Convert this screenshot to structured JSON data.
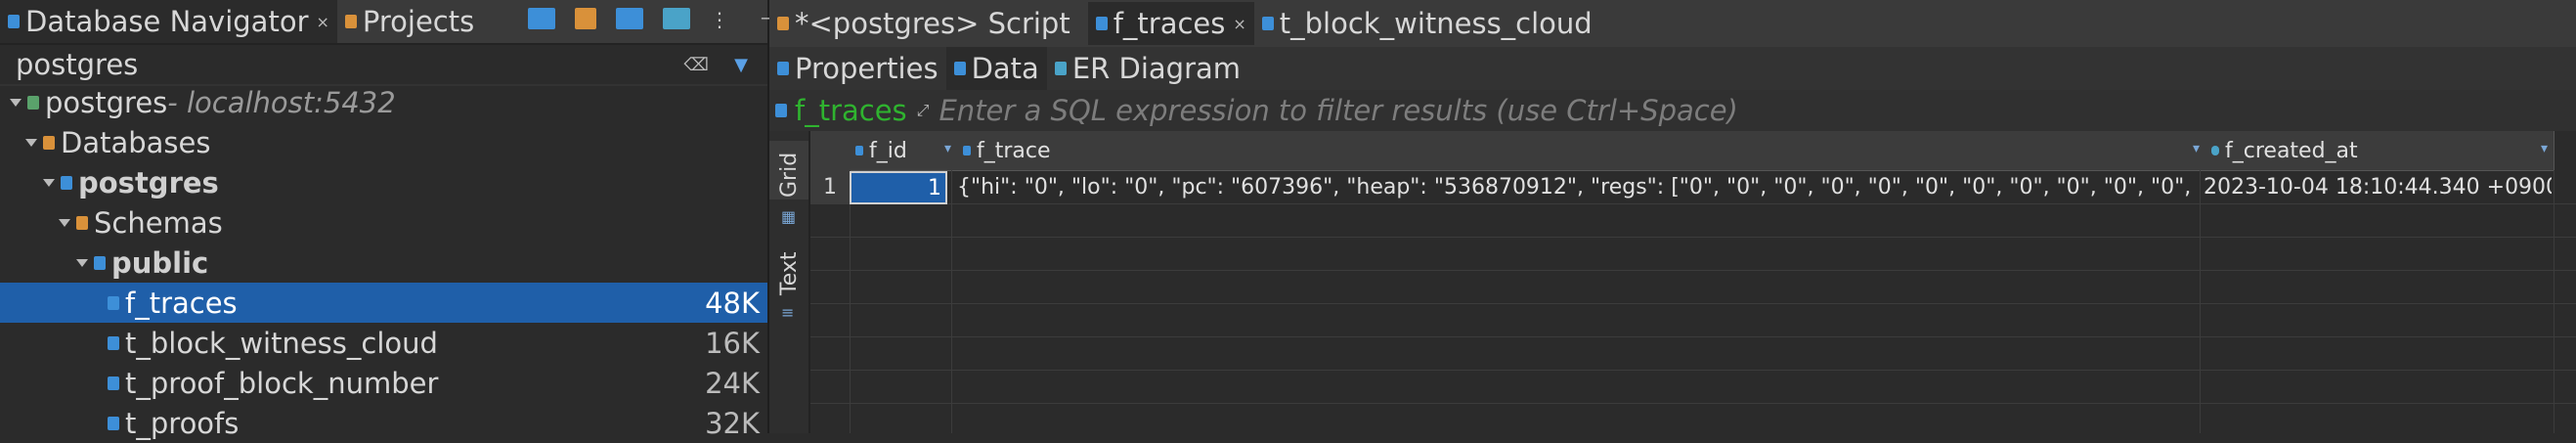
{
  "left_panel": {
    "tabs": [
      {
        "label": "Database Navigator",
        "close": "×"
      },
      {
        "label": "Projects"
      }
    ],
    "filter_text": "postgres",
    "tree": [
      {
        "label": "postgres",
        "suffix": " - localhost:5432"
      },
      {
        "label": "Databases"
      },
      {
        "label": "postgres"
      },
      {
        "label": "Schemas"
      },
      {
        "label": "public"
      },
      {
        "label": "f_traces",
        "size": "48K"
      },
      {
        "label": "t_block_witness_cloud",
        "size": "16K"
      },
      {
        "label": "t_proof_block_number",
        "size": "24K"
      },
      {
        "label": "t_proofs",
        "size": "32K"
      }
    ]
  },
  "editor": {
    "tabs": [
      {
        "label": "*<postgres> Script"
      },
      {
        "label": "f_traces",
        "close": "×"
      },
      {
        "label": "t_block_witness_cloud"
      }
    ],
    "sub_tabs": [
      "Properties",
      "Data",
      "ER Diagram"
    ],
    "filter": {
      "table_name": "f_traces",
      "placeholder": "Enter a SQL expression to filter results (use Ctrl+Space)"
    },
    "vertical_tabs": [
      "Grid",
      "Text"
    ],
    "grid": {
      "columns": [
        "f_id",
        "f_trace",
        "f_created_at"
      ],
      "rows": [
        {
          "num": "1",
          "f_id": "1",
          "f_trace": "{\"hi\": \"0\", \"lo\": \"0\", \"pc\": \"607396\", \"heap\": \"536870912\", \"regs\": [\"0\", \"0\", \"0\", \"0\", \"0\", \"0\", \"0\", \"0\", \"0\", \"0\", \"0\", \"0\", \"0\",",
          "f_created_at": "2023-10-04 18:10:44.340 +0900"
        }
      ]
    }
  },
  "colors": {
    "background": "#2b2b2b",
    "selection": "#1f5fa9",
    "filter_name_green": "#2fb32f"
  }
}
